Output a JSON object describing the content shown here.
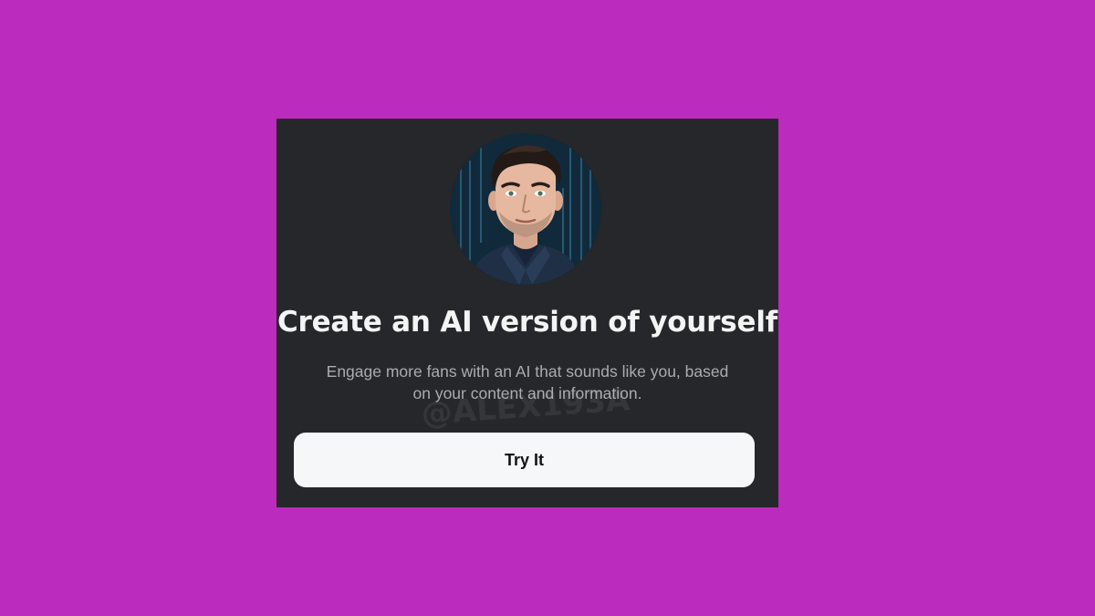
{
  "card": {
    "title": "Create an AI version of yourself",
    "subtitle_line1": "Engage more fans with an AI that sounds like you, based",
    "subtitle_line2": "on your content and information.",
    "watermark": "@ALEX193A",
    "button_label": "Try It"
  },
  "avatar": {
    "icon": "cartoon-portrait-avatar"
  },
  "colors": {
    "page_background": "#bb2bbd",
    "card_background": "#25272a",
    "title_text": "#f4f4f4",
    "subtitle_text": "#a9acb0",
    "button_background": "#f6f7f9",
    "button_text": "#111111"
  }
}
